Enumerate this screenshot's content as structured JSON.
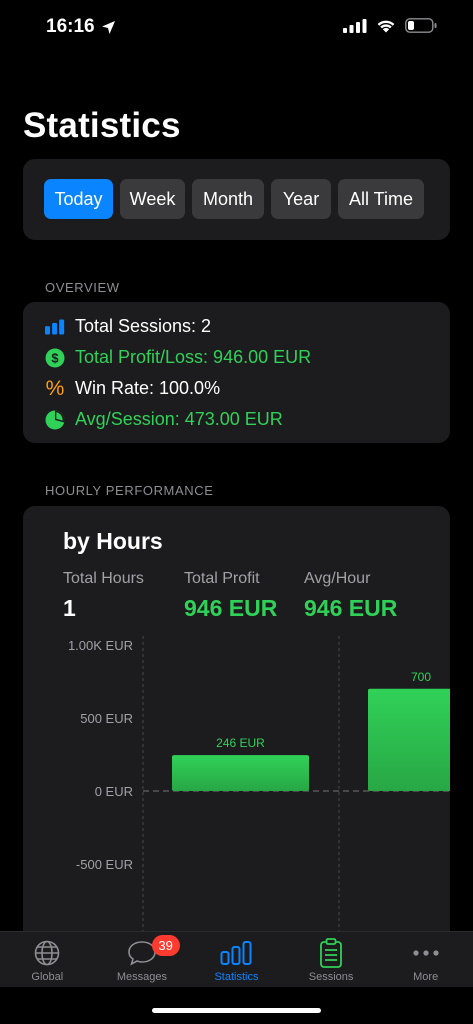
{
  "status_bar": {
    "time": "16:16"
  },
  "page": {
    "title": "Statistics"
  },
  "filters": [
    {
      "label": "Today",
      "active": true
    },
    {
      "label": "Week",
      "active": false
    },
    {
      "label": "Month",
      "active": false
    },
    {
      "label": "Year",
      "active": false
    },
    {
      "label": "All Time",
      "active": false
    }
  ],
  "overview": {
    "header": "OVERVIEW",
    "total_sessions": "Total Sessions: 2",
    "total_profit": "Total Profit/Loss: 946.00 EUR",
    "win_rate": "Win Rate: 100.0%",
    "avg_session": "Avg/Session: 473.00 EUR",
    "win_rate_symbol": "%",
    "profit_symbol": "$"
  },
  "hourly": {
    "header": "HOURLY PERFORMANCE",
    "title": "by Hours",
    "total_hours_label": "Total Hours",
    "total_hours_value": "1",
    "total_profit_label": "Total Profit",
    "total_profit_value": "946 EUR",
    "avg_hour_label": "Avg/Hour",
    "avg_hour_value": "946 EUR"
  },
  "chart_data": {
    "type": "bar",
    "categories": [
      "",
      ""
    ],
    "values": [
      246,
      700
    ],
    "data_labels": [
      "246 EUR",
      "700"
    ],
    "y_ticks": [
      {
        "value": 1000,
        "label": "1.00K EUR"
      },
      {
        "value": 500,
        "label": "500 EUR"
      },
      {
        "value": 0,
        "label": "0 EUR"
      },
      {
        "value": -500,
        "label": "-500 EUR"
      }
    ],
    "ylim": [
      -1000,
      1030
    ],
    "color": "#30d158"
  },
  "tab_bar": {
    "tabs": [
      {
        "label": "Global",
        "icon": "globe-icon",
        "active": false
      },
      {
        "label": "Messages",
        "icon": "chat-bubble-icon",
        "active": false,
        "badge": "39"
      },
      {
        "label": "Statistics",
        "icon": "bar-chart-icon",
        "active": true
      },
      {
        "label": "Sessions",
        "icon": "clipboard-icon",
        "active": false
      },
      {
        "label": "More",
        "icon": "ellipsis-icon",
        "active": false
      }
    ]
  },
  "colors": {
    "accent": "#0a84ff",
    "positive": "#30d158",
    "card": "#1c1c1e",
    "win_rate_icon": "#ff9f0a",
    "badge": "#ff3b30"
  }
}
